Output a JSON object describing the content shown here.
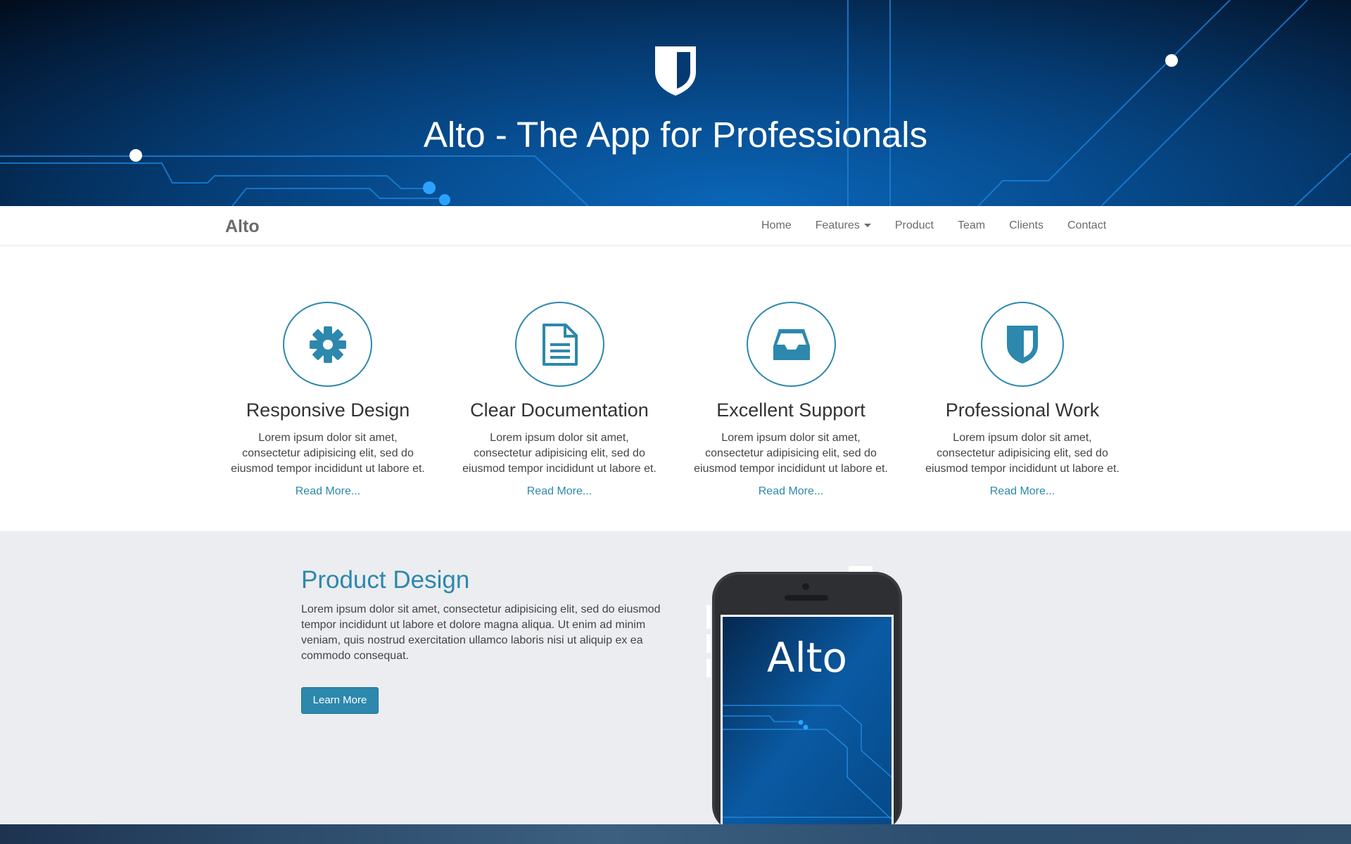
{
  "hero": {
    "title": "Alto - The App for Professionals",
    "logo_icon": "shield-icon"
  },
  "navbar": {
    "brand": "Alto",
    "items": [
      {
        "label": "Home"
      },
      {
        "label": "Features",
        "has_dropdown": true
      },
      {
        "label": "Product"
      },
      {
        "label": "Team"
      },
      {
        "label": "Clients"
      },
      {
        "label": "Contact"
      }
    ]
  },
  "features": [
    {
      "icon": "gear-icon",
      "title": "Responsive Design",
      "text": "Lorem ipsum dolor sit amet, consectetur adipisicing elit, sed do eiusmod tempor incididunt ut labore et.",
      "link": "Read More..."
    },
    {
      "icon": "document-icon",
      "title": "Clear Documentation",
      "text": "Lorem ipsum dolor sit amet, consectetur adipisicing elit, sed do eiusmod tempor incididunt ut labore et.",
      "link": "Read More..."
    },
    {
      "icon": "inbox-icon",
      "title": "Excellent Support",
      "text": "Lorem ipsum dolor sit amet, consectetur adipisicing elit, sed do eiusmod tempor incididunt ut labore et.",
      "link": "Read More..."
    },
    {
      "icon": "shield-icon",
      "title": "Professional Work",
      "text": "Lorem ipsum dolor sit amet, consectetur adipisicing elit, sed do eiusmod tempor incididunt ut labore et.",
      "link": "Read More..."
    }
  ],
  "product": {
    "title": "Product Design",
    "text": "Lorem ipsum dolor sit amet, consectetur adipisicing elit, sed do eiusmod tempor incididunt ut labore et dolore magna aliqua. Ut enim ad minim veniam, quis nostrud exercitation ullamco laboris nisi ut aliquip ex ea commodo consequat.",
    "button": "Learn More",
    "phone_screen_text": "Alto"
  },
  "colors": {
    "accent": "#2d88ad",
    "hero_dark": "#031c3a",
    "hero_light": "#0a66b8",
    "product_bg": "#ecedf0"
  }
}
